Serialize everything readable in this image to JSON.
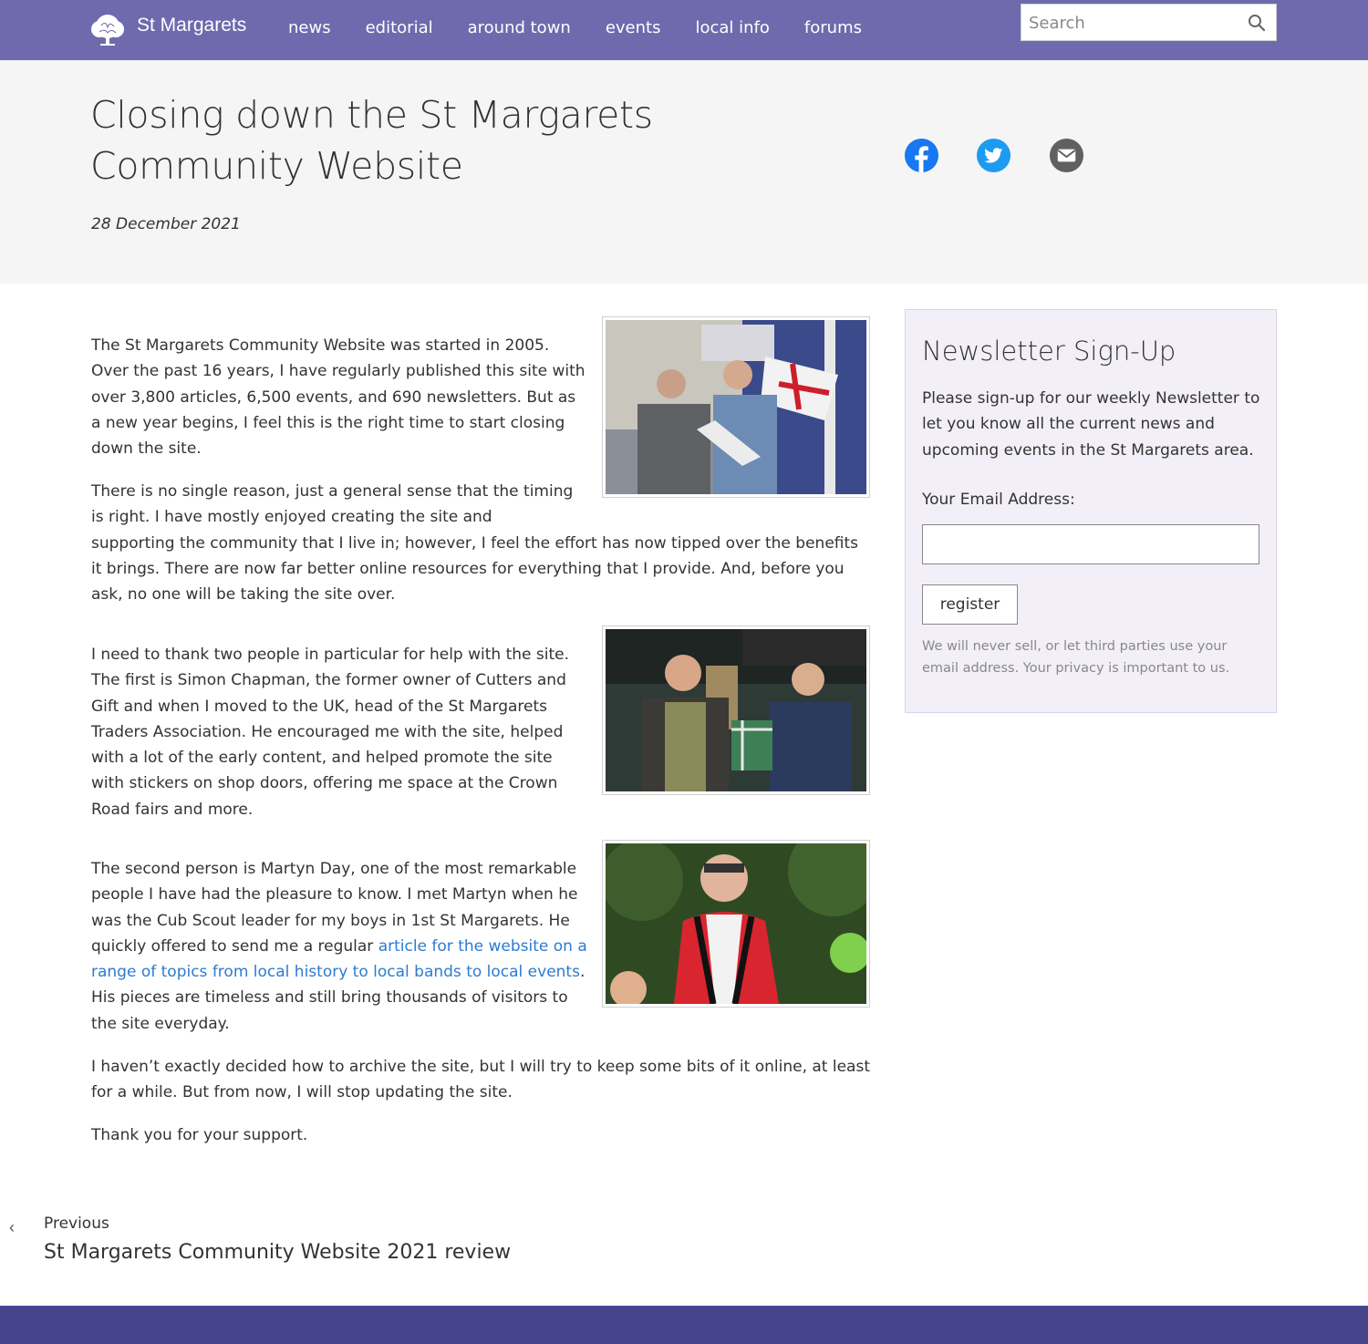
{
  "site": {
    "brand": "St Margarets",
    "logo_icon": "tree-logo-icon"
  },
  "nav": {
    "items": [
      "news",
      "editorial",
      "around town",
      "events",
      "local info",
      "forums"
    ]
  },
  "search": {
    "placeholder": "Search",
    "icon": "magnifier-icon"
  },
  "article": {
    "title": "Closing down the St Margarets Community Website",
    "date": "28 December 2021",
    "share": [
      "facebook-icon",
      "twitter-icon",
      "email-icon"
    ],
    "paragraphs": {
      "p1": "The St Margarets Community Website was started in 2005. Over the past 16 years, I have regularly published this site with over 3,800 articles, 6,500 events, and 690 newsletters. But as a new year begins, I feel this is the right time to start closing down the site.",
      "p2": "There is no single reason, just a general sense that the timing is right. I have mostly enjoyed creating the site and supporting the community that I live in; however, I feel the effort has now tipped over the benefits it brings. There are now far better online resources for everything that I provide. And, before you ask, no one will be taking the site over.",
      "p3": "I need to thank two people in particular for help with the site. The first is Simon Chapman, the former owner of Cutters and Gift and when I moved to the UK, head of the St Margarets Traders Association. He encouraged me with the site, helped with a lot of the early content, and helped promote the site with stickers on shop doors, offering me space at the Crown Road fairs and more.",
      "p4_before": "The second person is Martyn Day, one of the most remarkable people I have had the pleasure to know. I met Martyn when he was the Cub Scout leader for my boys in 1st St Margarets. He quickly offered to send me a regular ",
      "p4_link": "article for the website on a range of topics from local history to local bands to local events",
      "p4_after": ". His pieces are timeless and still bring thousands of visitors to the site everyday.",
      "p5": "I haven’t exactly decided how to archive the site, but I will try to keep some bits of it online, at least for a while. But from now, I will stop updating the site.",
      "p6": "Thank you for your support."
    }
  },
  "newsletter": {
    "title": "Newsletter Sign-Up",
    "text": "Please sign-up for our weekly Newsletter to let you know all the current news and upcoming events in the St Margarets area.",
    "email_label": "Your Email Address:",
    "email_value": "",
    "button": "register",
    "privacy": "We will never sell, or let third parties use your email address. Your privacy is important to us."
  },
  "pager": {
    "prev_label": "Previous",
    "prev_title": "St Margarets Community Website 2021 review",
    "prev_icon": "chevron-left-icon"
  },
  "colors": {
    "nav_bg": "#6e6aad",
    "footer_bg": "#46458c",
    "link": "#2d7bcf",
    "facebook": "#1877f2",
    "twitter": "#1d9bf0",
    "email": "#606060"
  }
}
